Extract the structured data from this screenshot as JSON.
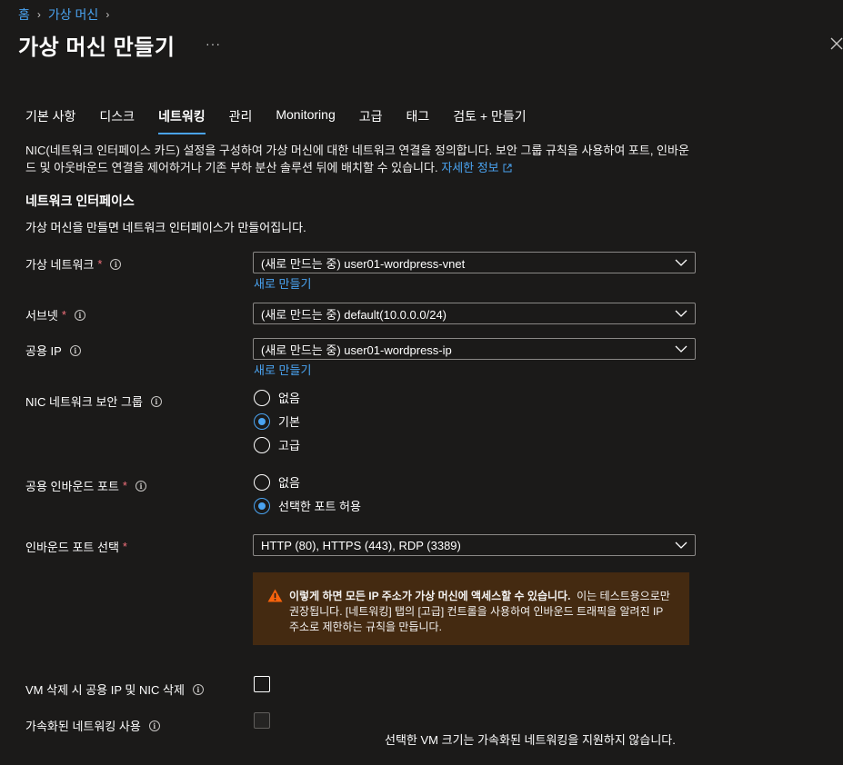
{
  "breadcrumb": {
    "home": "홈",
    "vm": "가상 머신"
  },
  "page": {
    "title": "가상 머신 만들기",
    "more": "···"
  },
  "tabs": [
    {
      "label": "기본 사항"
    },
    {
      "label": "디스크"
    },
    {
      "label": "네트워킹"
    },
    {
      "label": "관리"
    },
    {
      "label": "Monitoring"
    },
    {
      "label": "고급"
    },
    {
      "label": "태그"
    },
    {
      "label": "검토 + 만들기"
    }
  ],
  "active_tab": "네트워킹",
  "intro": {
    "text": "NIC(네트워크 인터페이스 카드) 설정을 구성하여 가상 머신에 대한 네트워크 연결을 정의합니다. 보안 그룹 규칙을 사용하여 포트, 인바운드 및 아웃바운드 연결을 제어하거나 기존 부하 분산 솔루션 뒤에 배치할 수 있습니다.",
    "link": "자세한 정보"
  },
  "section": {
    "title": "네트워크 인터페이스",
    "desc": "가상 머신을 만들면 네트워크 인터페이스가 만들어집니다."
  },
  "fields": {
    "vnet": {
      "label": "가상 네트워크",
      "value": "(새로 만드는 중) user01-wordpress-vnet",
      "create_new": "새로 만들기"
    },
    "subnet": {
      "label": "서브넷",
      "value": "(새로 만드는 중) default(10.0.0.0/24)"
    },
    "public_ip": {
      "label": "공용 IP",
      "value": "(새로 만드는 중) user01-wordpress-ip",
      "create_new": "새로 만들기"
    },
    "nsg": {
      "label": "NIC 네트워크 보안 그룹",
      "options": [
        "없음",
        "기본",
        "고급"
      ],
      "selected": "기본"
    },
    "inbound_ports": {
      "label": "공용 인바운드 포트",
      "options": [
        "없음",
        "선택한 포트 허용"
      ],
      "selected": "선택한 포트 허용"
    },
    "select_ports": {
      "label": "인바운드 포트 선택",
      "value": "HTTP (80), HTTPS (443), RDP (3389)"
    },
    "delete_ip_nic": {
      "label": "VM 삭제 시 공용 IP 및 NIC 삭제",
      "checked": false
    },
    "accel_net": {
      "label": "가속화된 네트워킹 사용",
      "checked": false,
      "disabled": true,
      "note": "선택한 VM 크기는 가속화된 네트워킹을 지원하지 않습니다."
    }
  },
  "required_mark": "*",
  "warning": {
    "bold": "이렇게 하면 모든 IP 주소가 가상 머신에 액세스할 수 있습니다.",
    "text": "이는 테스트용으로만 권장됩니다. [네트워킹] 탭의 [고급] 컨트롤을 사용하여 인바운드 트래픽을 알려진 IP 주소로 제한하는 규칙을 만듭니다."
  },
  "colors": {
    "background": "#1b1a19",
    "accent": "#4aa3f0",
    "required": "#f1707b",
    "warning_bg": "#442a11",
    "warning_icon": "#f7630c"
  }
}
